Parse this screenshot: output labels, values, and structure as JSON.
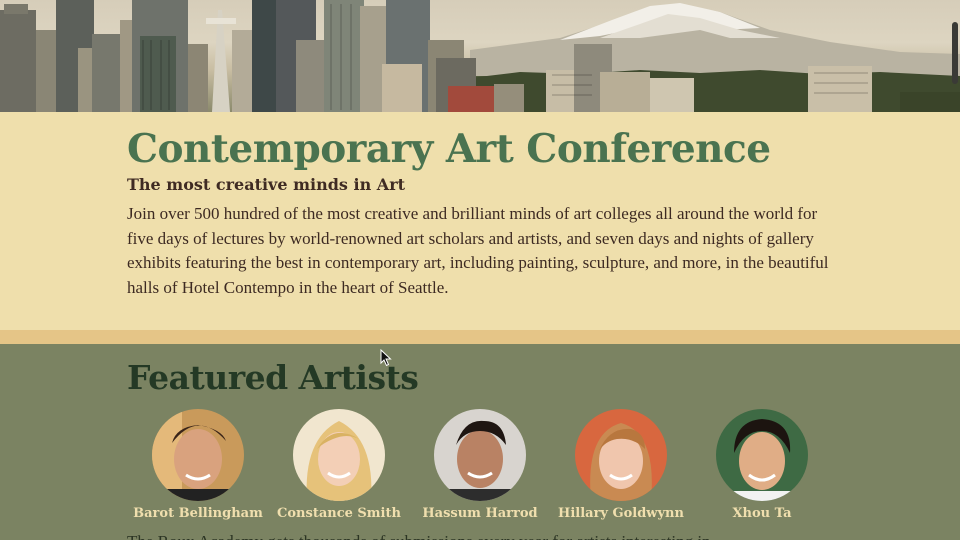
{
  "hero": {
    "image_label": "Seattle skyline with Mount Rainier"
  },
  "intro": {
    "title": "Contemporary Art Conference",
    "subtitle": "The most creative minds in Art",
    "body": "Join over 500 hundred of the most creative and brilliant minds of art colleges all around the world for five days of lectures by world-renowned art scholars and artists, and seven days and nights of gallery exhibits featuring the best in contemporary art, including painting, sculpture, and more, in the beautiful halls of Hotel Contempo in the heart of Seattle."
  },
  "featured": {
    "heading": "Featured Artists",
    "artists": [
      {
        "name": "Barot Bellingham"
      },
      {
        "name": "Constance Smith"
      },
      {
        "name": "Hassum Harrod"
      },
      {
        "name": "Hillary Goldwynn"
      },
      {
        "name": "Xhou Ta"
      }
    ],
    "more_text": "The Roux Academy gets thousands of submissions every year for artists interesting in"
  },
  "colors": {
    "intro_bg": "#efdfac",
    "title": "#4a7350",
    "featured_bg": "#7b8362",
    "artist_name": "#f0dfae",
    "divider": "#e5c587"
  }
}
